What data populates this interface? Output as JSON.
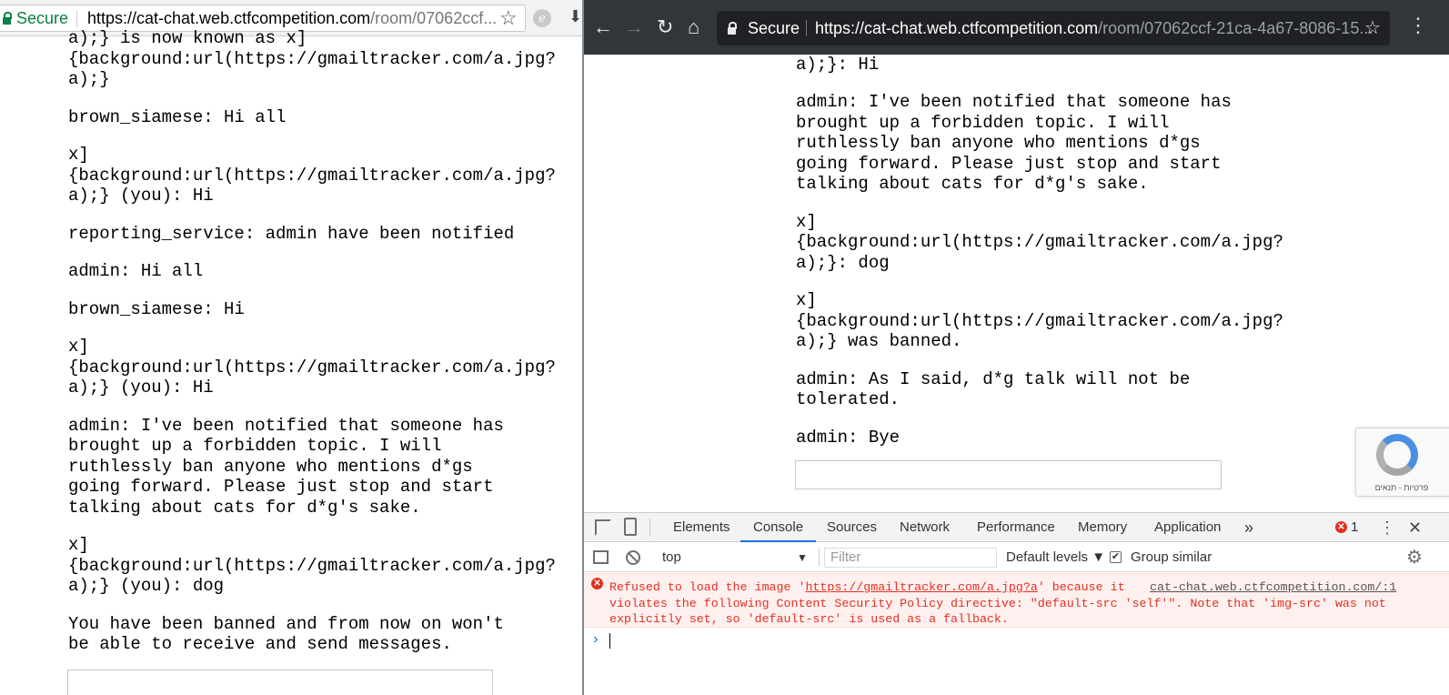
{
  "left_window": {
    "secure_label": "Secure",
    "url_main": "https://cat-chat.web.ctfcompetition.com",
    "url_rest": "/room/07062ccf...",
    "star_icon": "☆",
    "extension_icon": "ℯ",
    "download_icon": "⬇",
    "messages": [
      "a);} is now known as x]",
      "{background:url(https://gmailtracker.com/a.jpg?\na);}",
      "brown_siamese: Hi all",
      "x]\n{background:url(https://gmailtracker.com/a.jpg?\na);} (you): Hi",
      "reporting_service: admin have been notified",
      "admin: Hi all",
      "brown_siamese: Hi",
      "x]\n{background:url(https://gmailtracker.com/a.jpg?\na);} (you): Hi",
      "admin: I've been notified that someone has\nbrought up a forbidden topic. I will\nruthlessly ban anyone who mentions d*gs\ngoing forward. Please just stop and start\ntalking about cats for d*g's sake.",
      "x]\n{background:url(https://gmailtracker.com/a.jpg?\na);} (you): dog",
      "You have been banned and from now on won't\nbe able to receive and send messages."
    ]
  },
  "right_window": {
    "secure_label": "Secure",
    "url_main": "https://cat-chat.web.ctfcompetition.com",
    "url_rest": "/room/07062ccf-21ca-4a67-8086-15...",
    "nav": {
      "back": "←",
      "forward": "→",
      "reload": "↻",
      "home": "⌂",
      "star": "☆",
      "menu": "⋮"
    },
    "messages": [
      "{background:url(https://gmailtracker.com/a.jpg?\na);}: Hi",
      "admin: I've been notified that someone has\nbrought up a forbidden topic. I will\nruthlessly ban anyone who mentions d*gs\ngoing forward. Please just stop and start\ntalking about cats for d*g's sake.",
      "x]\n{background:url(https://gmailtracker.com/a.jpg?\na);}: dog",
      "x]\n{background:url(https://gmailtracker.com/a.jpg?\na);} was banned.",
      "admin: As I said, d*g talk will not be\ntolerated.",
      "admin: Bye"
    ],
    "recaptcha_text": "פרטיות - תנאים"
  },
  "devtools": {
    "tabs": [
      "Elements",
      "Console",
      "Sources",
      "Network",
      "Performance",
      "Memory",
      "Application"
    ],
    "more_tabs": "»",
    "error_count": "1",
    "kebab": "⋮",
    "close": "✕",
    "context": "top",
    "context_arrow": "▼",
    "filter_placeholder": "Filter",
    "levels": "Default levels ▼",
    "checkbox": "✔",
    "group_similar": "Group similar",
    "gear": "⚙",
    "error_icon": "✕",
    "error_prefix": "Refused to load the image '",
    "error_url": "https://gmailtracker.com/a.jpg?a",
    "error_suffix": "' because it\nviolates the following Content Security Policy directive: \"default-src 'self'\". Note that 'img-src' was not\nexplicitly set, so 'default-src' is used as a fallback.",
    "error_source": "cat-chat.web.ctfcompetition.com/:1",
    "prompt": "›"
  }
}
